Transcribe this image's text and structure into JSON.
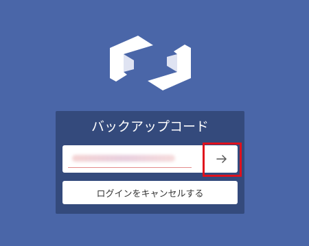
{
  "logo": {
    "icon": "shield-link-logo",
    "color": "#ffffff",
    "shade_color": "#dfe3f2"
  },
  "dialog": {
    "title": "バックアップコード",
    "code_input": {
      "value": "",
      "obscured": true
    },
    "submit_icon": "arrow-right-icon",
    "cancel_label": "ログインをキャンセルする"
  },
  "annotation": {
    "highlight_color": "#e0101c"
  },
  "colors": {
    "background": "#4a66a8",
    "panel": "#344a7c",
    "button": "#ffffff",
    "arrow": "#555555"
  }
}
